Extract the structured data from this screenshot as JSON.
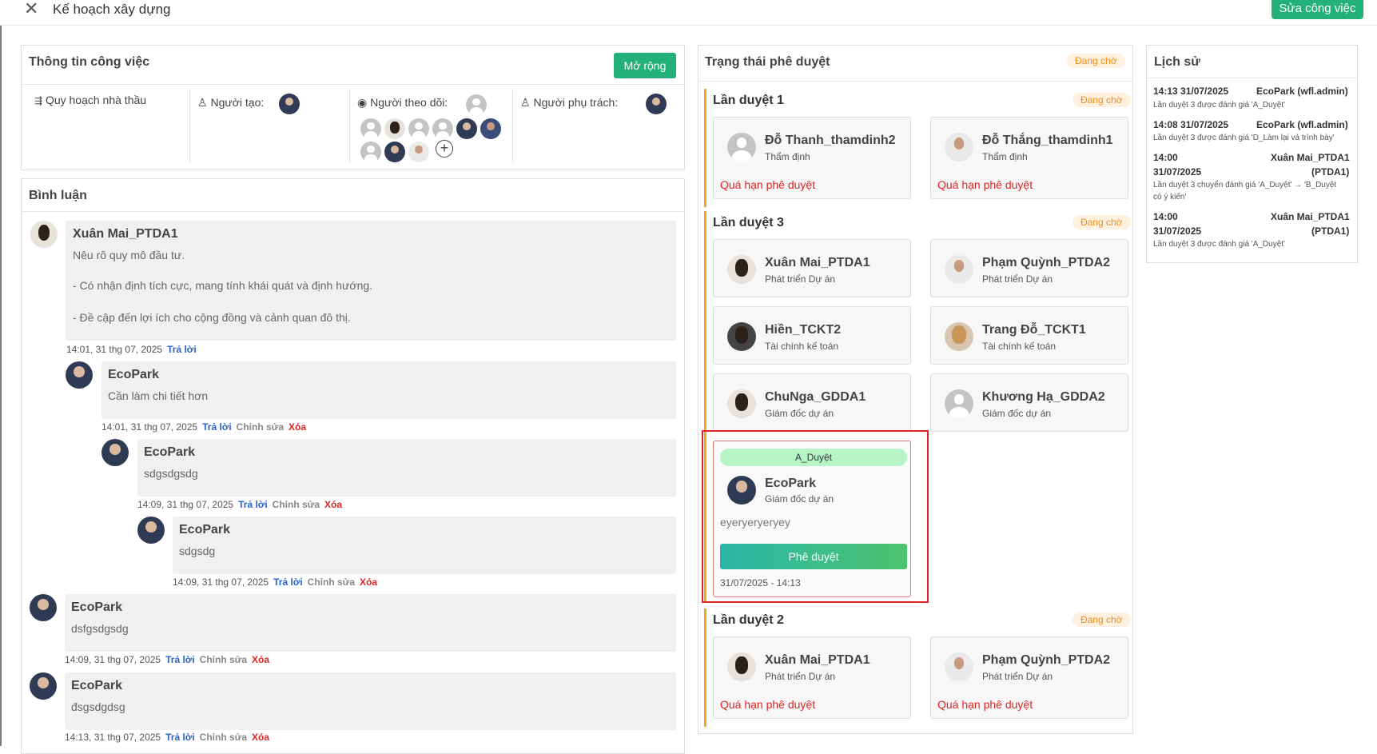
{
  "header": {
    "close_icon": "close-icon",
    "title": "Kế hoạch xây dựng",
    "edit_button": "Sửa công việc"
  },
  "task_info": {
    "title": "Thông tin công việc",
    "expand_button": "Mở rộng",
    "plan_label": "Quy hoạch nhà thầu",
    "creator_label": "Người tạo:",
    "followers_label": "Người theo dõi:",
    "owner_label": "Người phụ trách:"
  },
  "comments": {
    "title": "Bình luận",
    "reply": "Trả lời",
    "edit": "Chỉnh sửa",
    "delete": "Xóa",
    "items": [
      {
        "author": "Xuân Mai_PTDA1",
        "line1": "Nêu rõ quy mô đầu tư.",
        "line2": "- Có nhận định tích cực, mang tính khái quát và định hướng.",
        "line3": "- Đề cập đến lợi ích cho cộng đồng và cảnh quan đô thị.",
        "time": "14:01, 31 thg 07, 2025"
      },
      {
        "author": "EcoPark",
        "text": "Cần làm chi tiết hơn",
        "time": "14:01, 31 thg 07, 2025"
      },
      {
        "author": "EcoPark",
        "text": "sdgsdgsdg",
        "time": "14:09, 31 thg 07, 2025"
      },
      {
        "author": "EcoPark",
        "text": "sdgsdg",
        "time": "14:09, 31 thg 07, 2025"
      },
      {
        "author": "EcoPark",
        "text": "dsfgsdgsdg",
        "time": "14:09, 31 thg 07, 2025"
      },
      {
        "author": "EcoPark",
        "text": "đsgsdgdsg",
        "time": "14:13, 31 thg 07, 2025"
      }
    ]
  },
  "approval": {
    "title": "Trạng thái phê duyệt",
    "status": "Đang chờ",
    "overdue": "Quá hạn phê duyệt",
    "round1": {
      "title": "Lần duyệt 1",
      "status": "Đang chờ",
      "a": {
        "name": "Đỗ Thanh_thamdinh2",
        "role": "Thẩm định"
      },
      "b": {
        "name": "Đỗ Thắng_thamdinh1",
        "role": "Thẩm định"
      }
    },
    "round3": {
      "title": "Lần duyệt 3",
      "status": "Đang chờ",
      "a": {
        "name": "Xuân Mai_PTDA1",
        "role": "Phát triển Dự án"
      },
      "b": {
        "name": "Phạm Quỳnh_PTDA2",
        "role": "Phát triển Dự án"
      },
      "c": {
        "name": "Hiền_TCKT2",
        "role": "Tài chính kế toán"
      },
      "d": {
        "name": "Trang Đỗ_TCKT1",
        "role": "Tài chính kế toán"
      },
      "e": {
        "name": "ChuNga_GDDA1",
        "role": "Giám đốc dự án"
      },
      "f": {
        "name": "Khương Hạ_GDDA2",
        "role": "Giám đốc dự án"
      },
      "approved": {
        "tag": "A_Duyệt",
        "name": "EcoPark",
        "role": "Giám đốc dự án",
        "comment": "eyeryeryeryey",
        "button": "Phê duyệt",
        "time": "31/07/2025 - 14:13"
      }
    },
    "round2": {
      "title": "Lần duyệt 2",
      "status": "Đang chờ",
      "a": {
        "name": "Xuân Mai_PTDA1",
        "role": "Phát triển Dự án"
      },
      "b": {
        "name": "Phạm Quỳnh_PTDA2",
        "role": "Phát triển Dự án"
      }
    }
  },
  "history": {
    "title": "Lịch sử",
    "items": [
      {
        "time": "14:13 31/07/2025",
        "user": "EcoPark (wfl.admin)",
        "desc": "Lần duyệt 3 được đánh giá 'A_Duyệt'"
      },
      {
        "time": "14:08 31/07/2025",
        "user": "EcoPark (wfl.admin)",
        "desc": "Lần duyệt 3 được đánh giá 'D_Làm lại và trình bày'"
      },
      {
        "time_a": "14:00",
        "time_b": "31/07/2025",
        "user_a": "Xuân Mai_PTDA1",
        "user_b": "(PTDA1)",
        "desc_a": "Lần duyệt 3 chuyển đánh giá 'A_Duyệt' → 'B_Duyệt",
        "desc_b": "có ý kiến'"
      },
      {
        "time_a": "14:00",
        "time_b": "31/07/2025",
        "user_a": "Xuân Mai_PTDA1",
        "user_b": "(PTDA1)",
        "desc": "Lần duyệt 3 được đánh giá 'A_Duyệt'"
      }
    ]
  }
}
